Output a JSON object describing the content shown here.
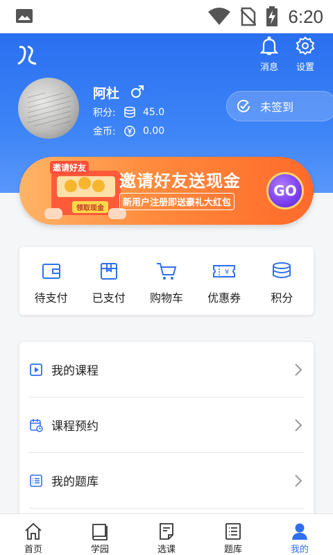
{
  "status_bar": {
    "time": "6:20"
  },
  "header": {
    "messages_label": "消息",
    "settings_label": "设置",
    "user": {
      "name": "阿杜",
      "gender_symbol": "♂",
      "points_label": "积分:",
      "points_value": "45.0",
      "coins_label": "金币:",
      "coins_value": "0.00"
    },
    "checkin_label": "未签到"
  },
  "banner": {
    "pack_header": "邀请好友",
    "pack_button": "领取现金",
    "title": "邀请好友送现金",
    "subtitle": "新用户注册即送豪礼大红包",
    "go_label": "GO"
  },
  "quick_actions": [
    {
      "label": "待支付",
      "icon": "wallet-icon"
    },
    {
      "label": "已支付",
      "icon": "box-icon"
    },
    {
      "label": "购物车",
      "icon": "cart-icon"
    },
    {
      "label": "优惠券",
      "icon": "coupon-icon"
    },
    {
      "label": "积分",
      "icon": "coins-icon"
    }
  ],
  "menu": [
    {
      "label": "我的课程",
      "icon": "play-icon"
    },
    {
      "label": "课程预约",
      "icon": "calendar-clock-icon"
    },
    {
      "label": "我的题库",
      "icon": "list-icon"
    }
  ],
  "bottom_nav": [
    {
      "label": "首页",
      "icon": "home-icon"
    },
    {
      "label": "学园",
      "icon": "book-icon"
    },
    {
      "label": "选课",
      "icon": "document-icon"
    },
    {
      "label": "题库",
      "icon": "list-icon"
    },
    {
      "label": "我的",
      "icon": "user-icon",
      "active": true
    }
  ],
  "colors": {
    "primary": "#2f6fee",
    "banner": "#ff8a3d"
  }
}
